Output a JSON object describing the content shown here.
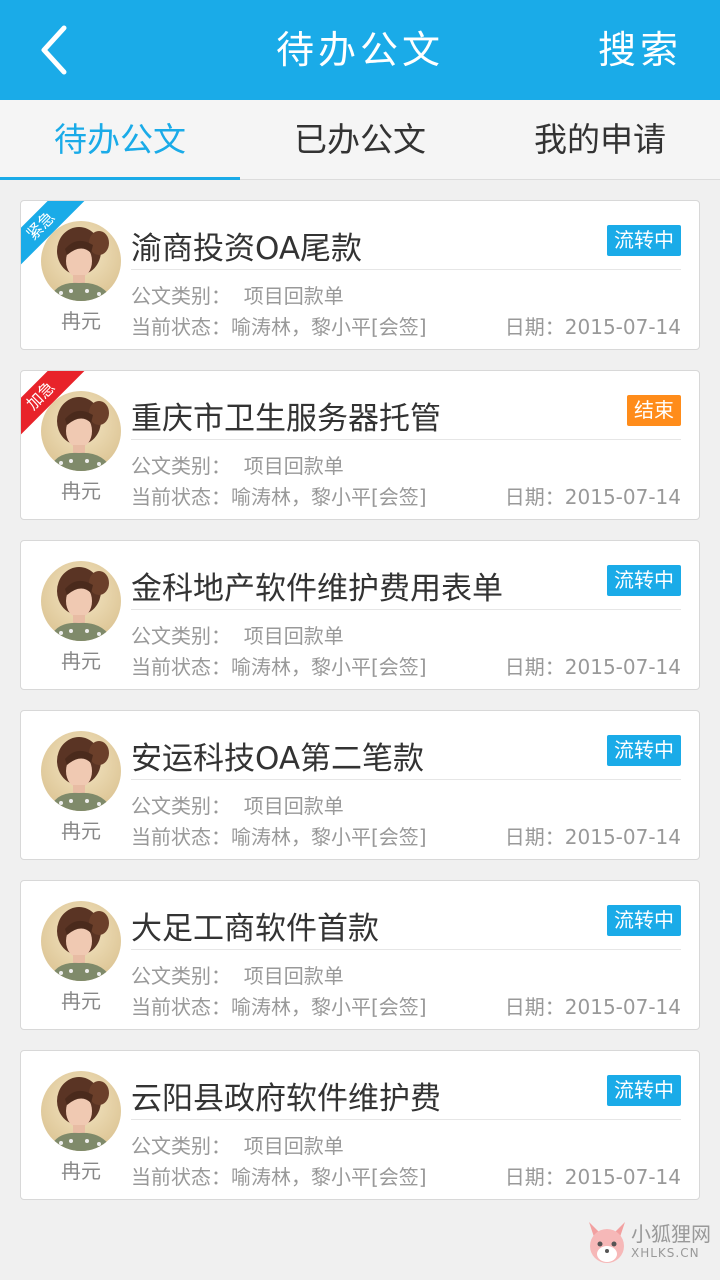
{
  "header": {
    "title": "待办公文",
    "back_icon": "chevron-left-icon",
    "search_label": "搜索"
  },
  "tabs": [
    {
      "label": "待办公文",
      "active": true
    },
    {
      "label": "已办公文",
      "active": false
    },
    {
      "label": "我的申请",
      "active": false
    }
  ],
  "colors": {
    "accent": "#1aabe8",
    "badge_flow": "#1aabe8",
    "badge_end": "#ff8c1a",
    "ribbon_urgent": "#1aabe8",
    "ribbon_rush": "#e8232a"
  },
  "documents": [
    {
      "title": "渝商投资OA尾款",
      "status": "流转中",
      "status_type": "flow",
      "ribbon": "紧急",
      "ribbon_type": "blue",
      "author": "冉元",
      "category_label": "公文类别：",
      "category": "项目回款单",
      "state_label": "当前状态：",
      "state": "喻涛林，黎小平[会签]",
      "date_label": "日期：",
      "date": "2015-07-14"
    },
    {
      "title": "重庆市卫生服务器托管",
      "status": "结束",
      "status_type": "end",
      "ribbon": "加急",
      "ribbon_type": "red",
      "author": "冉元",
      "category_label": "公文类别：",
      "category": "项目回款单",
      "state_label": "当前状态：",
      "state": "喻涛林，黎小平[会签]",
      "date_label": "日期：",
      "date": "2015-07-14"
    },
    {
      "title": "金科地产软件维护费用表单",
      "status": "流转中",
      "status_type": "flow",
      "ribbon": "",
      "ribbon_type": "",
      "author": "冉元",
      "category_label": "公文类别：",
      "category": "项目回款单",
      "state_label": "当前状态：",
      "state": "喻涛林，黎小平[会签]",
      "date_label": "日期：",
      "date": "2015-07-14"
    },
    {
      "title": "安运科技OA第二笔款",
      "status": "流转中",
      "status_type": "flow",
      "ribbon": "",
      "ribbon_type": "",
      "author": "冉元",
      "category_label": "公文类别：",
      "category": "项目回款单",
      "state_label": "当前状态：",
      "state": "喻涛林，黎小平[会签]",
      "date_label": "日期：",
      "date": "2015-07-14"
    },
    {
      "title": "大足工商软件首款",
      "status": "流转中",
      "status_type": "flow",
      "ribbon": "",
      "ribbon_type": "",
      "author": "冉元",
      "category_label": "公文类别：",
      "category": "项目回款单",
      "state_label": "当前状态：",
      "state": "喻涛林，黎小平[会签]",
      "date_label": "日期：",
      "date": "2015-07-14"
    },
    {
      "title": "云阳县政府软件维护费",
      "status": "流转中",
      "status_type": "flow",
      "ribbon": "",
      "ribbon_type": "",
      "author": "冉元",
      "category_label": "公文类别：",
      "category": "项目回款单",
      "state_label": "当前状态：",
      "state": "喻涛林，黎小平[会签]",
      "date_label": "日期：",
      "date": "2015-07-14"
    }
  ],
  "watermark": {
    "line1": "小狐狸网",
    "line2": "XHLKS.CN",
    "icon": "fox-logo-icon"
  }
}
